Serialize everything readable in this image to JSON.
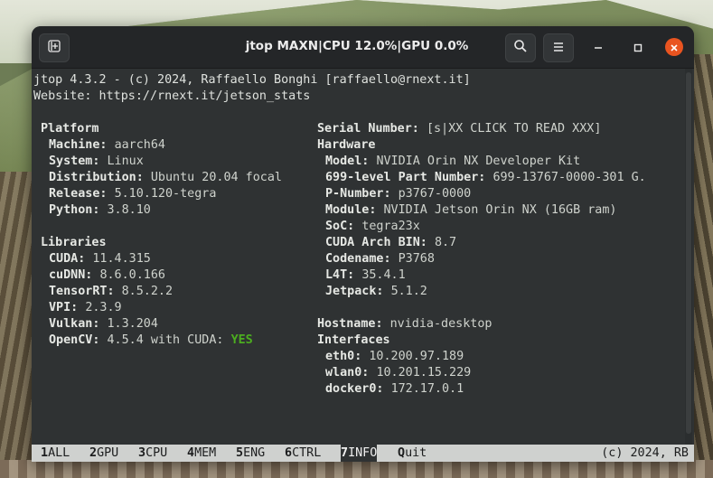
{
  "window": {
    "title": "jtop MAXN|CPU 12.0%|GPU 0.0%",
    "icons": {
      "new_tab": "new-tab-icon",
      "search": "search-icon",
      "menu": "hamburger-menu-icon",
      "minimize": "minimize-icon",
      "maximize": "maximize-icon",
      "close": "close-icon"
    },
    "colors": {
      "close_button": "#e95420",
      "terminal_bg": "#2f3233",
      "yes": "#4cae1f"
    }
  },
  "header": {
    "line1": "jtop 4.3.2 - (c) 2024, Raffaello Bonghi [raffaello@rnext.it]",
    "line2": "Website: https://rnext.it/jetson_stats"
  },
  "platform": {
    "title": "Platform",
    "rows": [
      {
        "key": "Machine:",
        "value": "aarch64"
      },
      {
        "key": "System:",
        "value": "Linux"
      },
      {
        "key": "Distribution:",
        "value": "Ubuntu 20.04 focal"
      },
      {
        "key": "Release:",
        "value": "5.10.120-tegra"
      },
      {
        "key": "Python:",
        "value": "3.8.10"
      }
    ]
  },
  "libraries": {
    "title": "Libraries",
    "rows": [
      {
        "key": "CUDA:",
        "value": "11.4.315"
      },
      {
        "key": "cuDNN:",
        "value": "8.6.0.166"
      },
      {
        "key": "TensorRT:",
        "value": "8.5.2.2"
      },
      {
        "key": "VPI:",
        "value": "2.3.9"
      },
      {
        "key": "Vulkan:",
        "value": "1.3.204"
      },
      {
        "key": "OpenCV:",
        "value": "4.5.4 with CUDA:",
        "extra": "YES"
      }
    ]
  },
  "serial": {
    "key": "Serial Number:",
    "value": "[s|XX CLICK TO READ XXX]"
  },
  "hardware": {
    "title": "Hardware",
    "rows": [
      {
        "key": "Model:",
        "value": "NVIDIA Orin NX Developer Kit"
      },
      {
        "key": "699-level Part Number:",
        "value": "699-13767-0000-301 G."
      },
      {
        "key": "P-Number:",
        "value": "p3767-0000"
      },
      {
        "key": "Module:",
        "value": "NVIDIA Jetson Orin NX (16GB ram)"
      },
      {
        "key": "SoC:",
        "value": "tegra23x"
      },
      {
        "key": "CUDA Arch BIN:",
        "value": "8.7"
      },
      {
        "key": "Codename:",
        "value": "P3768"
      },
      {
        "key": "L4T:",
        "value": "35.4.1"
      },
      {
        "key": "Jetpack:",
        "value": "5.1.2"
      }
    ]
  },
  "hostname": {
    "key": "Hostname:",
    "value": "nvidia-desktop"
  },
  "interfaces": {
    "title": "Interfaces",
    "rows": [
      {
        "key": "eth0:",
        "value": "10.200.97.189"
      },
      {
        "key": "wlan0:",
        "value": "10.201.15.229"
      },
      {
        "key": "docker0:",
        "value": "172.17.0.1"
      }
    ]
  },
  "menu": {
    "items": [
      {
        "num": "1",
        "label": "ALL"
      },
      {
        "num": "2",
        "label": "GPU"
      },
      {
        "num": "3",
        "label": "CPU"
      },
      {
        "num": "4",
        "label": "MEM"
      },
      {
        "num": "5",
        "label": "ENG"
      },
      {
        "num": "6",
        "label": "CTRL"
      },
      {
        "num": "7",
        "label": "INFO"
      },
      {
        "num": "Q",
        "label": "uit"
      }
    ],
    "active": "7INFO",
    "copyright": "(c) 2024, RB"
  }
}
